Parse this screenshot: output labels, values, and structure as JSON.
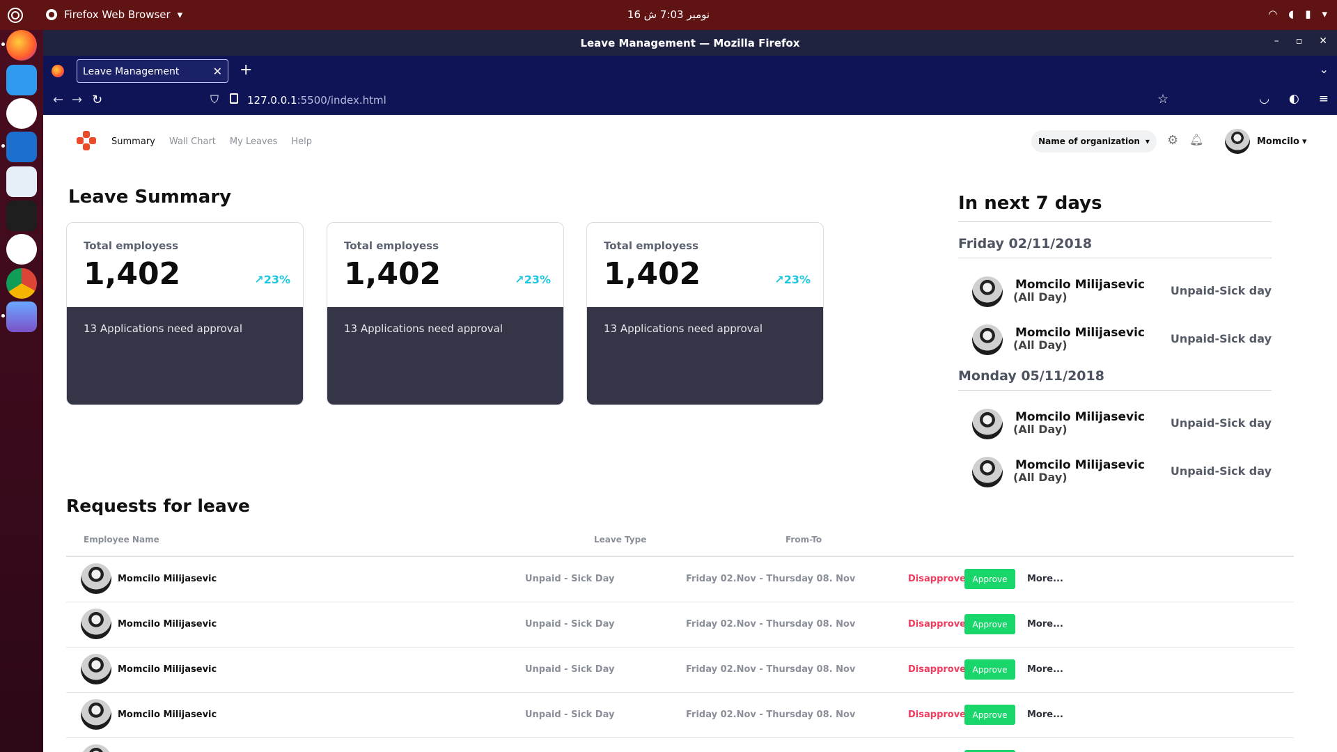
{
  "os_topbar": {
    "app_name": "Firefox Web Browser",
    "clock": "16 نومبر  7:03 ش"
  },
  "window": {
    "title": "Leave Management — Mozilla Firefox"
  },
  "browser": {
    "tab_title": "Leave Management",
    "url_host": "127.0.0.1",
    "url_rest": ":5500/index.html"
  },
  "app_nav": {
    "links": [
      "Summary",
      "Wall Chart",
      "My Leaves",
      "Help"
    ],
    "org_select": "Name of organization",
    "user_name": "Momcilo"
  },
  "summary": {
    "title": "Leave Summary",
    "cards": [
      {
        "label": "Total employess",
        "value": "1,402",
        "trend": "23%",
        "applications": "13 Applications need approval"
      },
      {
        "label": "Total employess",
        "value": "1,402",
        "trend": "23%",
        "applications": "13 Applications need approval"
      },
      {
        "label": "Total employess",
        "value": "1,402",
        "trend": "23%",
        "applications": "13 Applications need approval"
      }
    ]
  },
  "next_days": {
    "title": "In next 7 days",
    "days": [
      {
        "date": "Friday 02/11/2018",
        "entries": [
          {
            "name": "Momcilo Milijasevic",
            "duration": "(All Day)",
            "type": "Unpaid-Sick day"
          },
          {
            "name": "Momcilo Milijasevic",
            "duration": "(All Day)",
            "type": "Unpaid-Sick day"
          }
        ]
      },
      {
        "date": "Monday 05/11/2018",
        "entries": [
          {
            "name": "Momcilo Milijasevic",
            "duration": "(All Day)",
            "type": "Unpaid-Sick day"
          },
          {
            "name": "Momcilo Milijasevic",
            "duration": "(All Day)",
            "type": "Unpaid-Sick day"
          }
        ]
      }
    ]
  },
  "requests": {
    "title": "Requests for leave",
    "columns": [
      "Employee Name",
      "Leave Type",
      "From-To"
    ],
    "rows": [
      {
        "name": "Momcilo Milijasevic",
        "type": "Unpaid - Sick Day",
        "from_to": "Friday 02.Nov - Thursday 08. Nov",
        "disapprove": "Disapprove",
        "approve": "Approve",
        "more": "More..."
      },
      {
        "name": "Momcilo Milijasevic",
        "type": "Unpaid - Sick Day",
        "from_to": "Friday 02.Nov - Thursday 08. Nov",
        "disapprove": "Disapprove",
        "approve": "Approve",
        "more": "More..."
      },
      {
        "name": "Momcilo Milijasevic",
        "type": "Unpaid - Sick Day",
        "from_to": "Friday 02.Nov - Thursday 08. Nov",
        "disapprove": "Disapprove",
        "approve": "Approve",
        "more": "More..."
      },
      {
        "name": "Momcilo Milijasevic",
        "type": "Unpaid - Sick Day",
        "from_to": "Friday 02.Nov - Thursday 08. Nov",
        "disapprove": "Disapprove",
        "approve": "Approve",
        "more": "More..."
      }
    ]
  },
  "colors": {
    "accent_trend": "#1ec6df",
    "approve": "#19d66b",
    "disapprove": "#ef3b5e",
    "card_dark": "#343647",
    "logo": "#ea4c2a"
  }
}
